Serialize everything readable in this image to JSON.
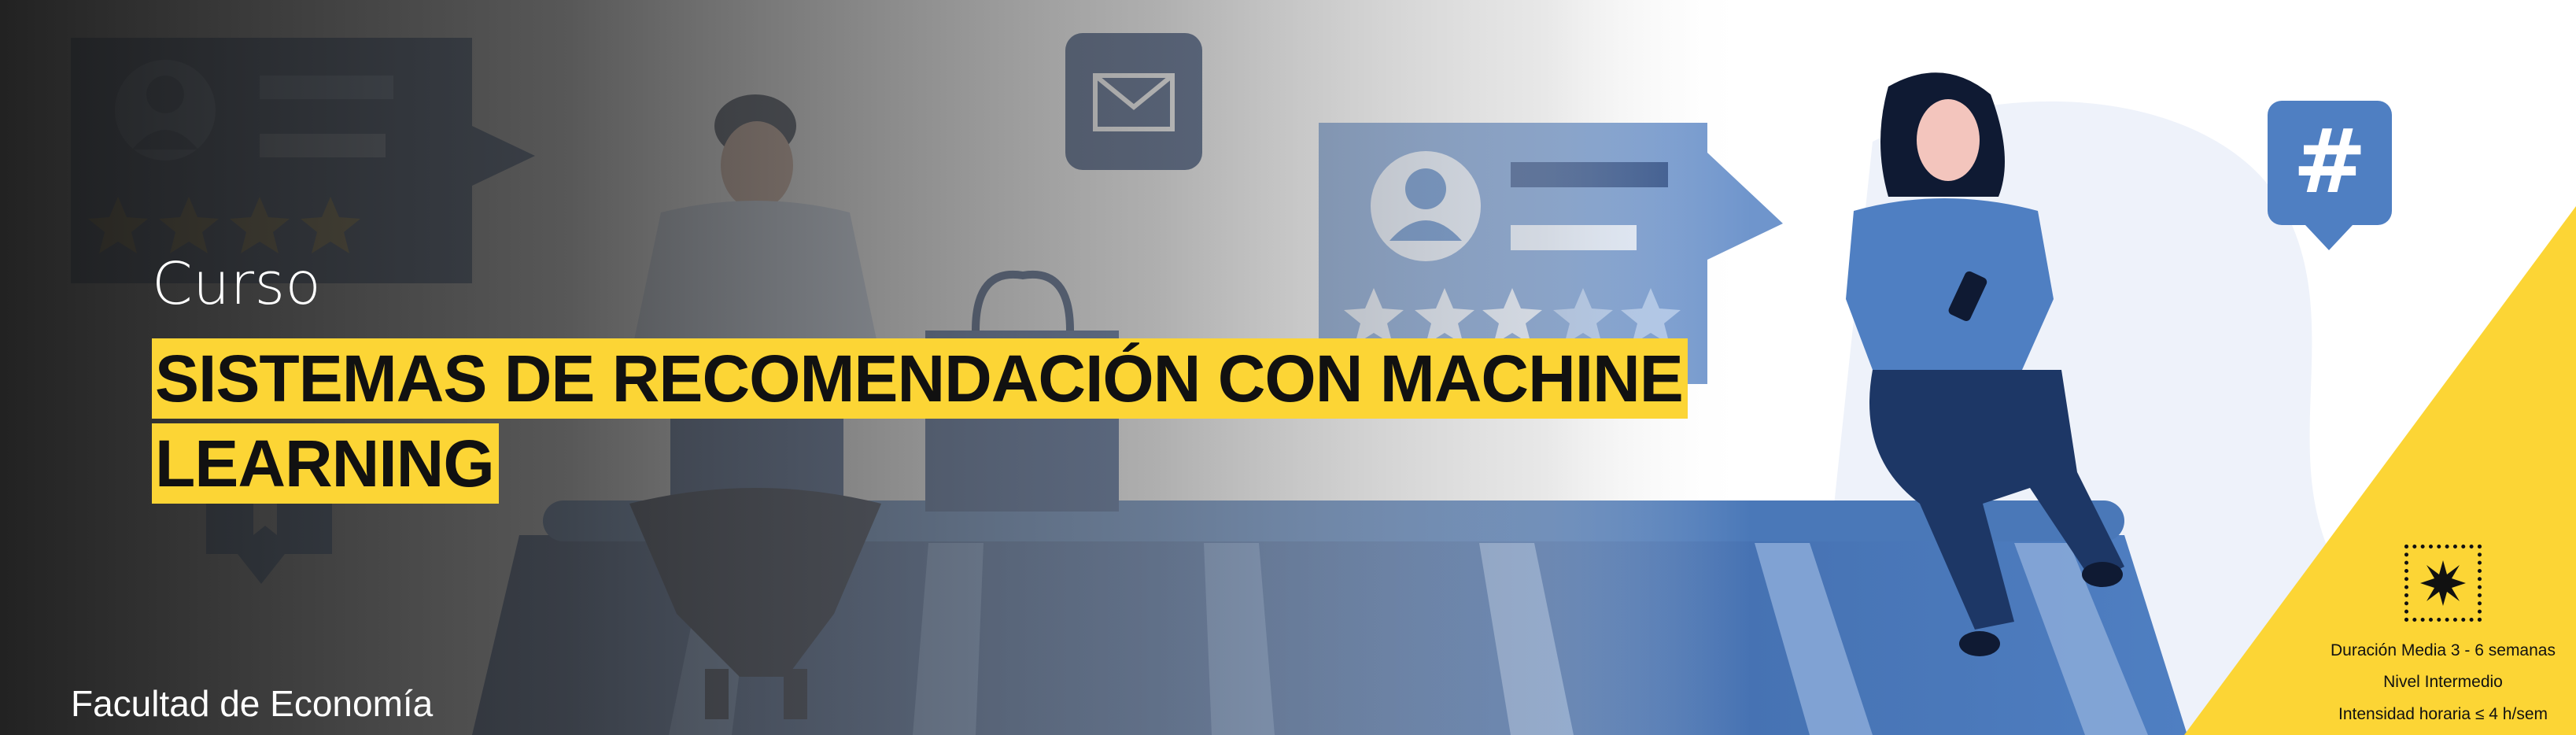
{
  "banner": {
    "course_label": "Curso",
    "title_line_1": "SISTEMAS DE RECOMENDACIÓN CON MACHINE",
    "title_line_2": "LEARNING",
    "faculty": "Facultad de Economía",
    "info": {
      "duration": "Duración Media 3 - 6 semanas",
      "level": "Nivel Intermedio",
      "intensity": "Intensidad horaria ≤ 4 h/sem"
    },
    "icons": [
      "mail-icon",
      "hashtag-icon",
      "review-card-icon",
      "star-icon",
      "shopping-bag-icon",
      "bookmark-icon",
      "starburst-icon"
    ],
    "colors": {
      "accent_yellow": "#fcd535",
      "dark_overlay": "#1e1e1e",
      "illustration_blue": "#3f6fb0",
      "navy": "#1c2f55"
    }
  }
}
